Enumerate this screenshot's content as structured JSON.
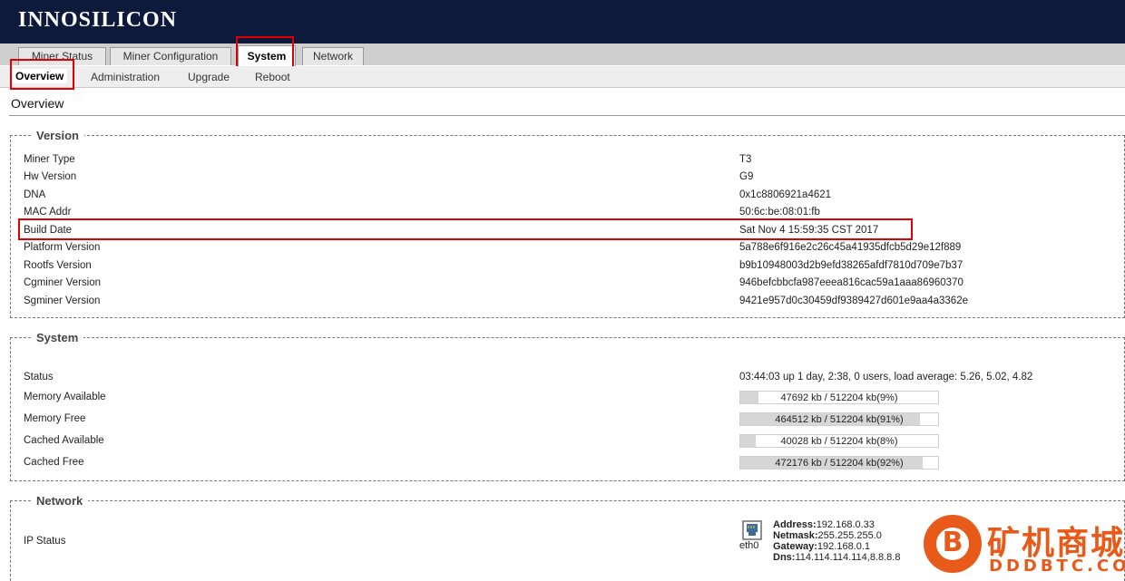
{
  "brand": "INNOSILICON",
  "tabs": [
    "Miner Status",
    "Miner Configuration",
    "System",
    "Network"
  ],
  "subtabs": [
    "Overview",
    "Administration",
    "Upgrade",
    "Reboot"
  ],
  "page_title": "Overview",
  "version": {
    "legend": "Version",
    "rows": [
      {
        "label": "Miner Type",
        "value": "T3"
      },
      {
        "label": "Hw Version",
        "value": "G9"
      },
      {
        "label": "DNA",
        "value": "0x1c8806921a4621"
      },
      {
        "label": "MAC Addr",
        "value": "50:6c:be:08:01:fb"
      },
      {
        "label": "Build Date",
        "value": "Sat Nov 4 15:59:35 CST 2017"
      },
      {
        "label": "Platform Version",
        "value": "5a788e6f916e2c26c45a41935dfcb5d29e12f889"
      },
      {
        "label": "Rootfs Version",
        "value": "b9b10948003d2b9efd38265afdf7810d709e7b37"
      },
      {
        "label": "Cgminer Version",
        "value": "946befcbbcfa987eeea816cac59a1aaa86960370"
      },
      {
        "label": "Sgminer Version",
        "value": "9421e957d0c30459df9389427d601e9aa4a3362e"
      }
    ]
  },
  "system": {
    "legend": "System",
    "status_label": "Status",
    "status_value": "03:44:03 up 1 day, 2:38, 0 users, load average: 5.26, 5.02, 4.82",
    "meters": [
      {
        "label": "Memory Available",
        "text": "47692 kb / 512204 kb(9%)",
        "fraction": 0.09
      },
      {
        "label": "Memory Free",
        "text": "464512 kb / 512204 kb(91%)",
        "fraction": 0.91
      },
      {
        "label": "Cached Available",
        "text": "40028 kb / 512204 kb(8%)",
        "fraction": 0.08
      },
      {
        "label": "Cached Free",
        "text": "472176 kb / 512204 kb(92%)",
        "fraction": 0.92
      }
    ]
  },
  "network": {
    "legend": "Network",
    "ip_status_label": "IP Status",
    "iface": "eth0",
    "address_label": "Address:",
    "address": "192.168.0.33",
    "netmask_label": "Netmask:",
    "netmask": "255.255.255.0",
    "gateway_label": "Gateway:",
    "gateway": "192.168.0.1",
    "dns_label": "Dns:",
    "dns": "114.114.114.114,8.8.8.8"
  },
  "watermark": {
    "cn": "矿机商城",
    "en": "DDDBTC.COM",
    "logo_letter": "B"
  },
  "colors": {
    "header_bg": "#0e1a3c",
    "highlight": "#e00000",
    "watermark": "#e85a1a"
  }
}
